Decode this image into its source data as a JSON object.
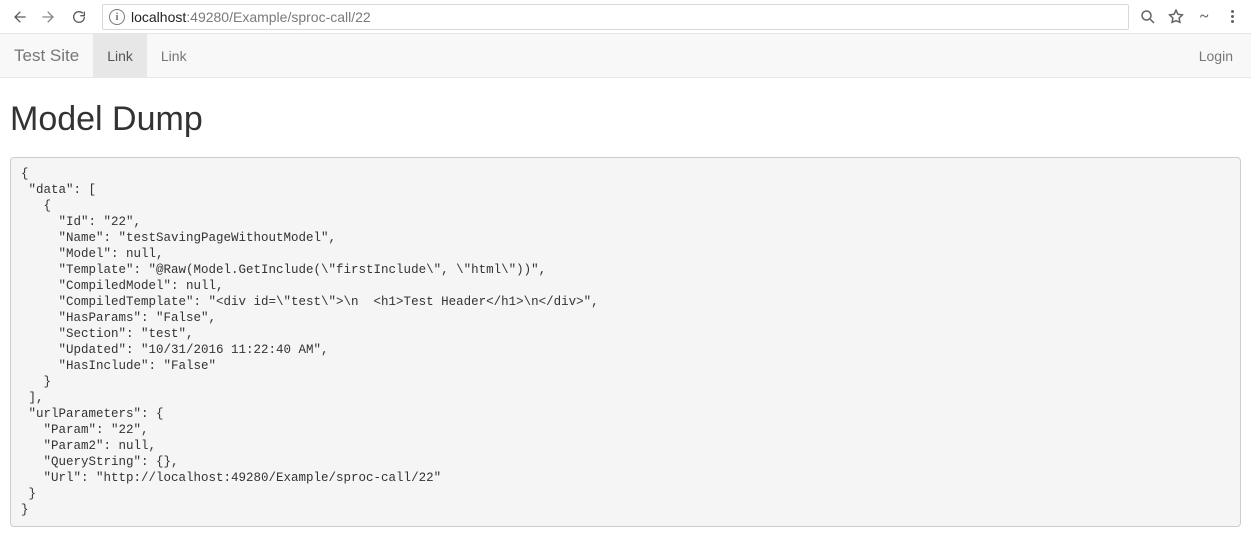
{
  "browser": {
    "url_host": "localhost",
    "url_port": ":49280",
    "url_path": "/Example/sproc-call/22"
  },
  "nav": {
    "brand": "Test Site",
    "links": [
      "Link",
      "Link"
    ],
    "login": "Login"
  },
  "page": {
    "title": "Model Dump"
  },
  "dump_text": "{\n \"data\": [\n   {\n     \"Id\": \"22\",\n     \"Name\": \"testSavingPageWithoutModel\",\n     \"Model\": null,\n     \"Template\": \"@Raw(Model.GetInclude(\\\"firstInclude\\\", \\\"html\\\"))\",\n     \"CompiledModel\": null,\n     \"CompiledTemplate\": \"<div id=\\\"test\\\">\\n  <h1>Test Header</h1>\\n</div>\",\n     \"HasParams\": \"False\",\n     \"Section\": \"test\",\n     \"Updated\": \"10/31/2016 11:22:40 AM\",\n     \"HasInclude\": \"False\"\n   }\n ],\n \"urlParameters\": {\n   \"Param\": \"22\",\n   \"Param2\": null,\n   \"QueryString\": {},\n   \"Url\": \"http://localhost:49280/Example/sproc-call/22\"\n }\n}",
  "dump_data_parsed": {
    "data": [
      {
        "Id": "22",
        "Name": "testSavingPageWithoutModel",
        "Model": null,
        "Template": "@Raw(Model.GetInclude(\"firstInclude\", \"html\"))",
        "CompiledModel": null,
        "CompiledTemplate": "<div id=\"test\">\n  <h1>Test Header</h1>\n</div>",
        "HasParams": "False",
        "Section": "test",
        "Updated": "10/31/2016 11:22:40 AM",
        "HasInclude": "False"
      }
    ],
    "urlParameters": {
      "Param": "22",
      "Param2": null,
      "QueryString": {},
      "Url": "http://localhost:49280/Example/sproc-call/22"
    }
  }
}
